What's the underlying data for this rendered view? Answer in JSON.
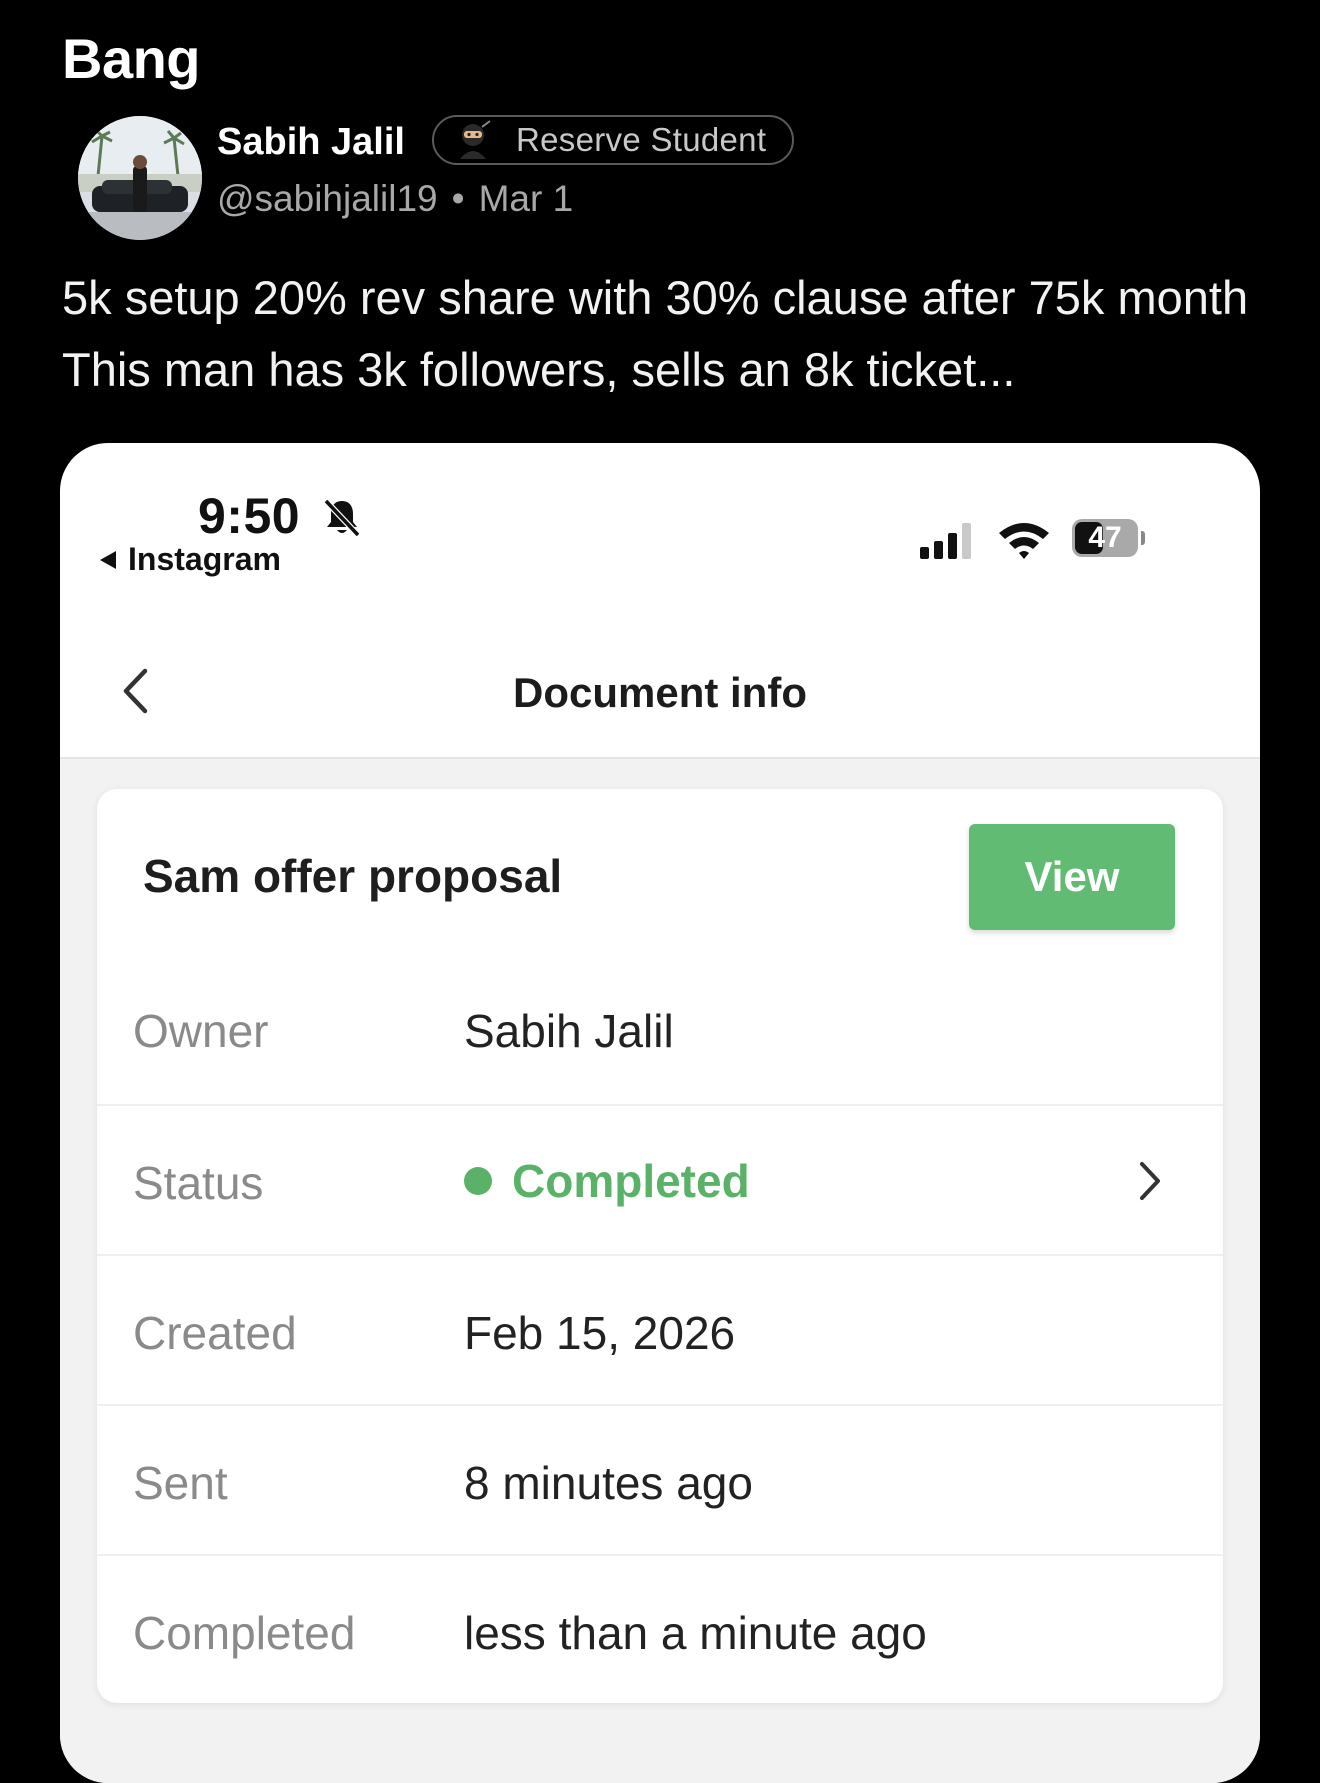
{
  "post": {
    "title": "Bang",
    "author_name": "Sabih Jalil",
    "badge_label": "Reserve Student",
    "handle": "@sabihjalil19",
    "separator": "•",
    "date": "Mar 1",
    "body": "5k setup 20% rev share with 30% clause after 75k month This man has 3k followers, sells an 8k ticket..."
  },
  "phone": {
    "status_bar": {
      "time": "9:50",
      "back_app": "Instagram",
      "battery": "47",
      "battery_fraction": 0.47
    },
    "nav": {
      "title": "Document info"
    },
    "document": {
      "title": "Sam offer proposal",
      "view_label": "View",
      "rows": [
        {
          "label": "Owner",
          "value": "Sabih Jalil"
        },
        {
          "label": "Status",
          "value": "Completed"
        },
        {
          "label": "Created",
          "value": "Feb 15, 2026"
        },
        {
          "label": "Sent",
          "value": "8 minutes ago"
        },
        {
          "label": "Completed",
          "value": "less than a minute ago"
        }
      ]
    },
    "colors": {
      "accent_green": "#62bb73",
      "status_green": "#59b268"
    }
  }
}
